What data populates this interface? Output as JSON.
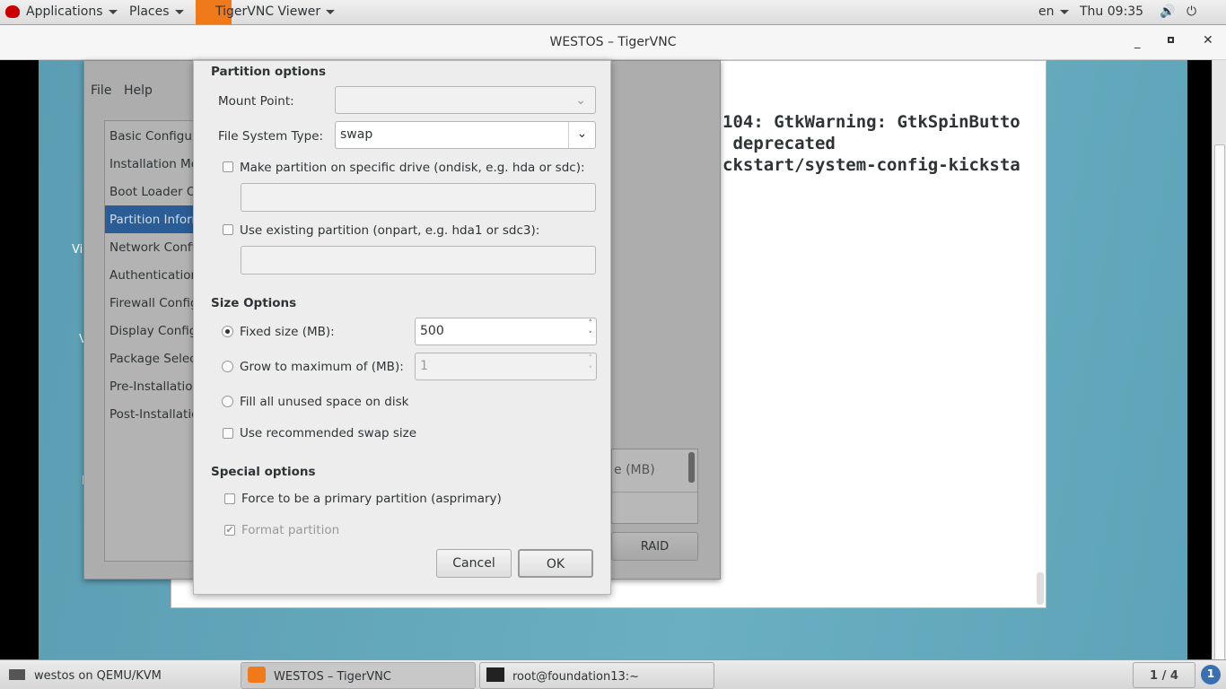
{
  "topbar": {
    "applications": "Applications",
    "places": "Places",
    "app_menu": "TigerVNC Viewer",
    "lang": "en",
    "clock": "Thu 09:35"
  },
  "window": {
    "title": "WESTOS – TigerVNC"
  },
  "terminal": {
    "lines": [
      "104: GtkWarning: GtkSpinButto",
      " deprecated",
      "ckstart/system-config-kicksta"
    ]
  },
  "kickstart": {
    "menu": [
      "File",
      "Help"
    ],
    "sections": [
      "Basic Configura",
      "Installation Me",
      "Boot Loader Op",
      "Partition Inform",
      "Network Confi",
      "Authentication",
      "Firewall Config",
      "Display Configu",
      "Package Select",
      "Pre-Installation",
      "Post-Installatio"
    ],
    "selected_index": 3,
    "table_header": "e (MB)",
    "raid_button": "RAID",
    "desktop_fragments": [
      "Vi",
      "V",
      "I"
    ]
  },
  "dialog": {
    "partition_options": "Partition options",
    "mount_point_label": "Mount Point:",
    "mount_point_value": "",
    "fs_type_label": "File System Type:",
    "fs_type_value": "swap",
    "ondisk_label": "Make partition on specific drive (ondisk, e.g. hda or sdc):",
    "ondisk_value": "",
    "ondisk_checked": false,
    "onpart_label": "Use existing partition (onpart, e.g. hda1 or sdc3):",
    "onpart_value": "",
    "onpart_checked": false,
    "size_options": "Size Options",
    "fixed_label": "Fixed size (MB):",
    "fixed_value": "500",
    "grow_label": "Grow to maximum of (MB):",
    "grow_value": "1",
    "fill_label": "Fill all unused space on disk",
    "size_choice": "fixed",
    "recommended_label": "Use recommended swap size",
    "recommended_checked": false,
    "special_options": "Special options",
    "primary_label": "Force to be a primary partition (asprimary)",
    "primary_checked": false,
    "format_label": "Format partition",
    "format_checked": true,
    "cancel": "Cancel",
    "ok": "OK"
  },
  "taskbar": {
    "tasks": [
      "westos on QEMU/KVM",
      "WESTOS – TigerVNC",
      "root@foundation13:~"
    ],
    "workspace": "1 / 4",
    "notifications": "1"
  }
}
